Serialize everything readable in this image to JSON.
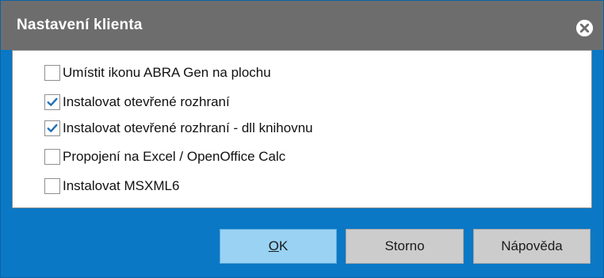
{
  "dialog": {
    "title": "Nastavení klienta",
    "close_icon": "close-circle-icon"
  },
  "options": [
    {
      "label": "Umístit ikonu ABRA Gen na plochu",
      "checked": false
    },
    {
      "label": "Instalovat otevřené rozhraní",
      "checked": true
    },
    {
      "label": "Instalovat otevřené rozhraní - dll knihovnu",
      "checked": true
    },
    {
      "label": "Propojení na Excel / OpenOffice Calc",
      "checked": false
    },
    {
      "label": "Instalovat MSXML6",
      "checked": false
    }
  ],
  "buttons": {
    "ok_mnemonic": "O",
    "ok_rest": "K",
    "cancel": "Storno",
    "help": "Nápověda"
  },
  "colors": {
    "titlebar": "#6d6d6d",
    "frame": "#0a78c5",
    "ok_button": "#99d2f3",
    "button": "#cccccc",
    "check": "#1f6fb5"
  }
}
